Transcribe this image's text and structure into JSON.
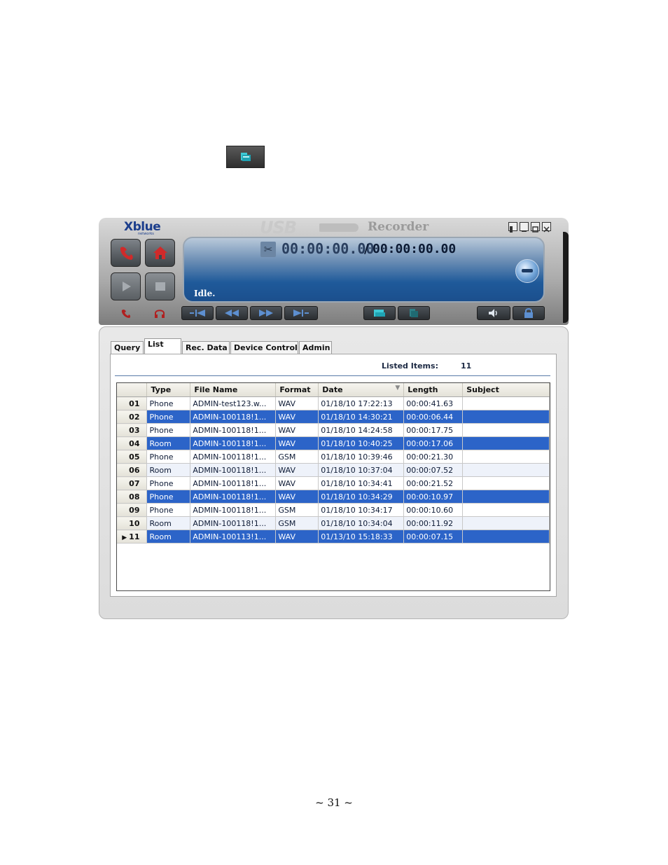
{
  "window": {
    "logo": "Xblue",
    "logo_sub": "networks",
    "title_usb": "USB",
    "title_recorder": "Recorder"
  },
  "display": {
    "current_time": "00:00:00.00",
    "separator": "/",
    "total_time": "00:00:00.00",
    "status": "Idle."
  },
  "tabs": [
    {
      "label": "Query"
    },
    {
      "label": "List"
    },
    {
      "label": "Rec. Data"
    },
    {
      "label": "Device Control"
    },
    {
      "label": "Admin"
    }
  ],
  "active_tab": "List",
  "summary": {
    "listed_items_label": "Listed Items:",
    "listed_items_value": "11"
  },
  "table": {
    "columns": [
      "Type",
      "File Name",
      "Format",
      "Date",
      "Length",
      "Subject"
    ],
    "rows": [
      {
        "num": "01",
        "type": "Phone",
        "file": "ADMIN-test123.w...",
        "format": "WAV",
        "date": "01/18/10 17:22:13",
        "length": "00:00:41.63",
        "subject": "",
        "selected": false
      },
      {
        "num": "02",
        "type": "Phone",
        "file": "ADMIN-100118!1...",
        "format": "WAV",
        "date": "01/18/10 14:30:21",
        "length": "00:00:06.44",
        "subject": "",
        "selected": true
      },
      {
        "num": "03",
        "type": "Phone",
        "file": "ADMIN-100118!1...",
        "format": "WAV",
        "date": "01/18/10 14:24:58",
        "length": "00:00:17.75",
        "subject": "",
        "selected": false
      },
      {
        "num": "04",
        "type": "Room",
        "file": "ADMIN-100118!1...",
        "format": "WAV",
        "date": "01/18/10 10:40:25",
        "length": "00:00:17.06",
        "subject": "",
        "selected": true
      },
      {
        "num": "05",
        "type": "Phone",
        "file": "ADMIN-100118!1...",
        "format": "GSM",
        "date": "01/18/10 10:39:46",
        "length": "00:00:21.30",
        "subject": "",
        "selected": false
      },
      {
        "num": "06",
        "type": "Room",
        "file": "ADMIN-100118!1...",
        "format": "WAV",
        "date": "01/18/10 10:37:04",
        "length": "00:00:07.52",
        "subject": "",
        "selected": false
      },
      {
        "num": "07",
        "type": "Phone",
        "file": "ADMIN-100118!1...",
        "format": "WAV",
        "date": "01/18/10 10:34:41",
        "length": "00:00:21.52",
        "subject": "",
        "selected": false
      },
      {
        "num": "08",
        "type": "Phone",
        "file": "ADMIN-100118!1...",
        "format": "WAV",
        "date": "01/18/10 10:34:29",
        "length": "00:00:10.97",
        "subject": "",
        "selected": true
      },
      {
        "num": "09",
        "type": "Phone",
        "file": "ADMIN-100118!1...",
        "format": "GSM",
        "date": "01/18/10 10:34:17",
        "length": "00:00:10.60",
        "subject": "",
        "selected": false
      },
      {
        "num": "10",
        "type": "Room",
        "file": "ADMIN-100118!1...",
        "format": "GSM",
        "date": "01/18/10 10:34:04",
        "length": "00:00:11.92",
        "subject": "",
        "selected": false
      },
      {
        "num": "11",
        "type": "Room",
        "file": "ADMIN-100113!1...",
        "format": "WAV",
        "date": "01/13/10 15:18:33",
        "length": "00:00:07.15",
        "subject": "",
        "selected": true,
        "current": true
      }
    ]
  },
  "icons": {
    "top_icon": "open-folder-icon",
    "phone": "phone-icon",
    "home": "home-icon",
    "play": "play-icon",
    "stop": "stop-icon",
    "scissors": "scissors-icon",
    "volume": "volume-icon",
    "lock": "lock-icon"
  },
  "colors": {
    "selection": "#2c64c8",
    "display_blue": "#1f5a9a"
  },
  "page_number": "~ 31 ~"
}
